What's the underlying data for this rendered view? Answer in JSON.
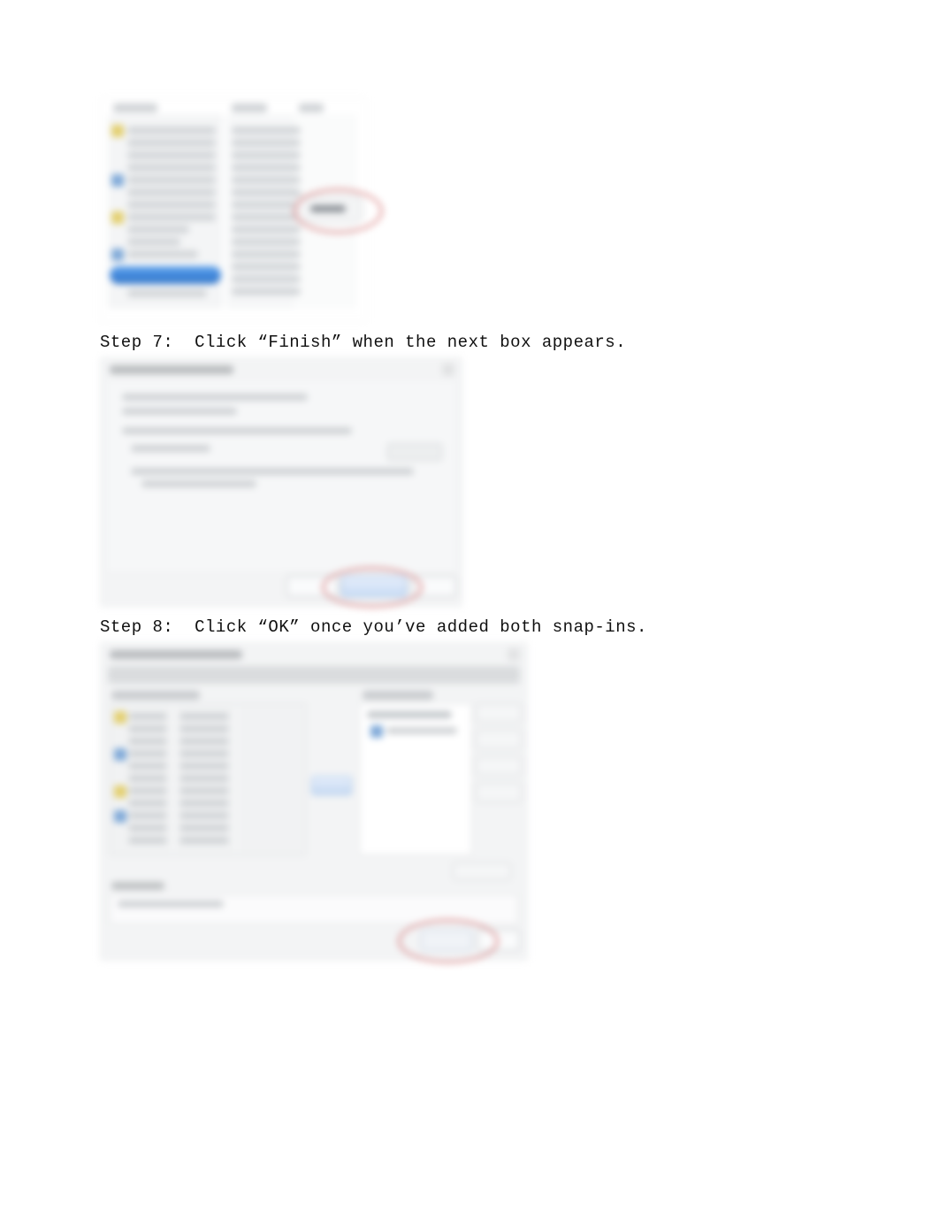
{
  "steps": {
    "step7": "Step 7:  Click “Finish” when the next box appears.",
    "step8": "Step 8:  Click “OK” once you’ve added both snap-ins."
  }
}
